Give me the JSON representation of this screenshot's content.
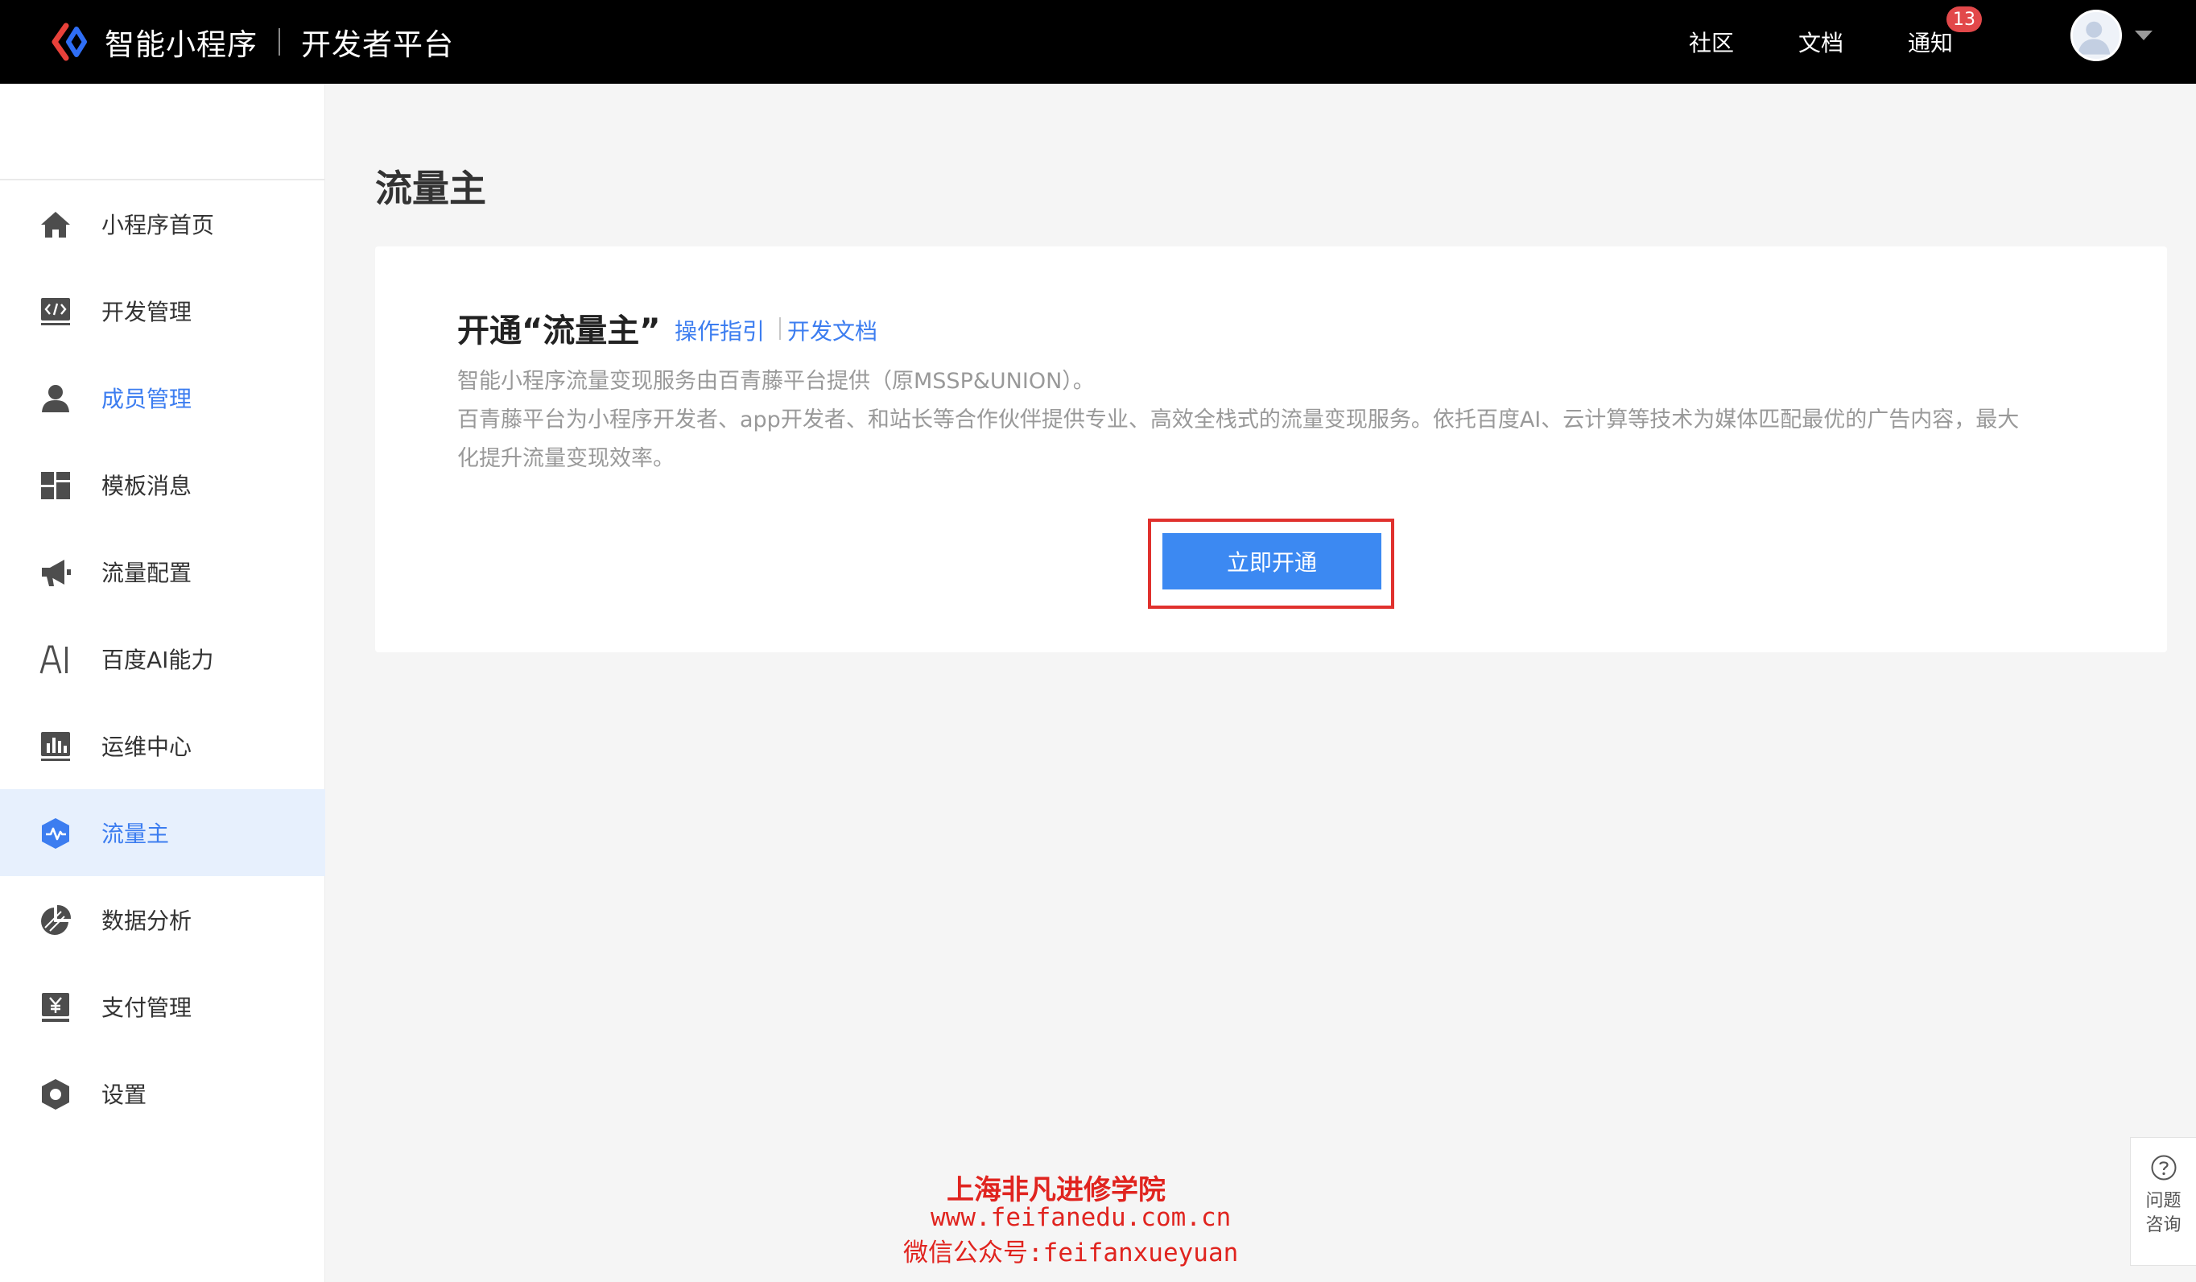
{
  "header": {
    "brand_name": "智能小程序",
    "brand_sub": "开发者平台",
    "nav": [
      {
        "label": "社区"
      },
      {
        "label": "文档"
      },
      {
        "label": "通知"
      }
    ],
    "notification_count": "13"
  },
  "sidebar": {
    "items": [
      {
        "label": "小程序首页",
        "icon": "home-icon"
      },
      {
        "label": "开发管理",
        "icon": "code-icon"
      },
      {
        "label": "成员管理",
        "icon": "user-icon"
      },
      {
        "label": "模板消息",
        "icon": "template-icon"
      },
      {
        "label": "流量配置",
        "icon": "megaphone-icon"
      },
      {
        "label": "百度AI能力",
        "icon": "ai-icon"
      },
      {
        "label": "运维中心",
        "icon": "chart-icon"
      },
      {
        "label": "流量主",
        "icon": "hexagon-pulse-icon",
        "active": true
      },
      {
        "label": "数据分析",
        "icon": "pie-icon"
      },
      {
        "label": "支付管理",
        "icon": "yuan-icon"
      },
      {
        "label": "设置",
        "icon": "gear-icon"
      }
    ]
  },
  "main": {
    "page_title": "流量主",
    "card": {
      "title": "开通“流量主”",
      "link_guide": "操作指引",
      "link_docs": "开发文档",
      "desc_line1": "智能小程序流量变现服务由百青藤平台提供（原MSSP&UNION）。",
      "desc_line2": "百青藤平台为小程序开发者、app开发者、和站长等合作伙伴提供专业、高效全栈式的流量变现服务。依托百度AI、云计算等技术为媒体匹配最优的广告内容，最大",
      "desc_line3": "化提升流量变现效率。",
      "cta_label": "立即开通"
    }
  },
  "watermark": {
    "line1": "上海非凡进修学院",
    "line2": "www.feifanedu.com.cn",
    "line3": "微信公众号:feifanxueyuan"
  },
  "help": {
    "label": "问题咨询"
  },
  "colors": {
    "accent": "#3c7df0",
    "cta": "#3c89f2",
    "highlight_frame": "#e0312d",
    "badge": "#e2484a"
  }
}
